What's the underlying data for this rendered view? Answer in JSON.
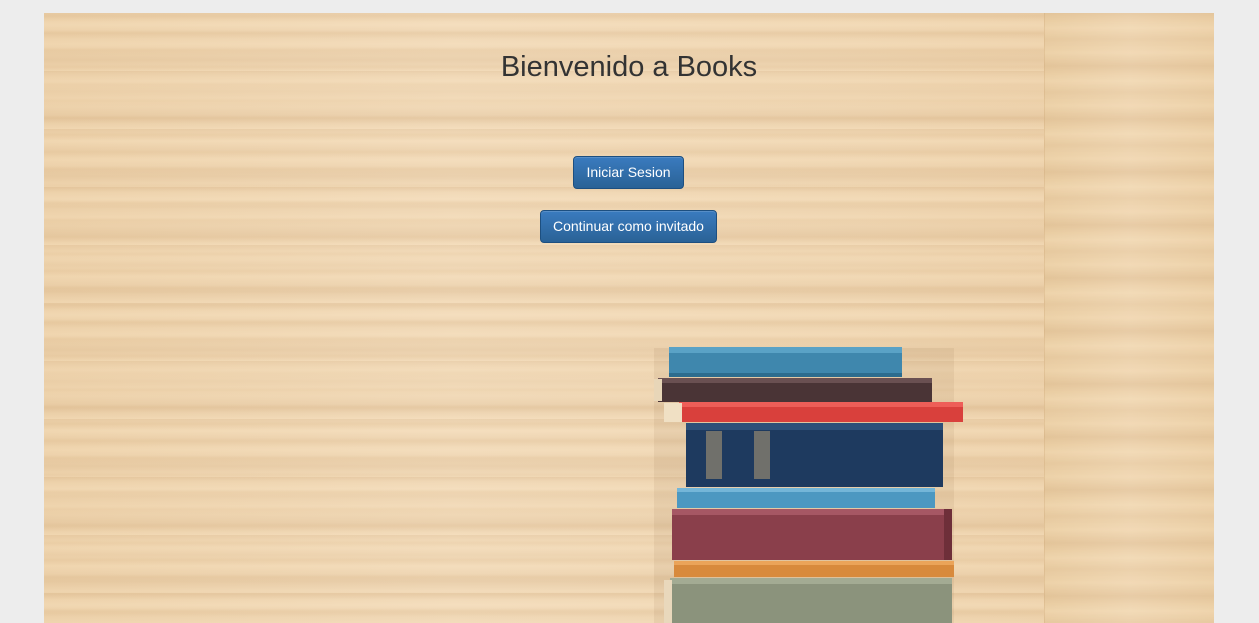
{
  "page": {
    "title": "Bienvenido a Books"
  },
  "actions": {
    "login_label": "Iniciar Sesion",
    "guest_label": "Continuar como invitado"
  },
  "colors": {
    "button_bg": "#2a6296",
    "button_border": "#1d4f80",
    "title_text": "#333333",
    "outer_bg": "#ededed"
  }
}
